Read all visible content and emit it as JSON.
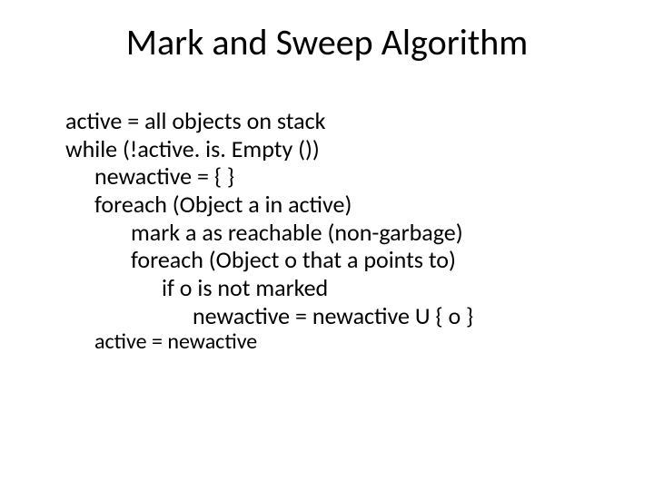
{
  "title": "Mark and Sweep Algorithm",
  "lines": {
    "l0": "active = all objects on stack",
    "l1": "while (!active. is. Empty ())",
    "l2": "newactive = { }",
    "l3": "foreach (Object a in active)",
    "l4": "mark a as reachable (non-garbage)",
    "l5": "foreach (Object o that a points to)",
    "l6": "if o is not marked",
    "l7": "newactive = newactive U { o }",
    "l8": "active = newactive"
  }
}
